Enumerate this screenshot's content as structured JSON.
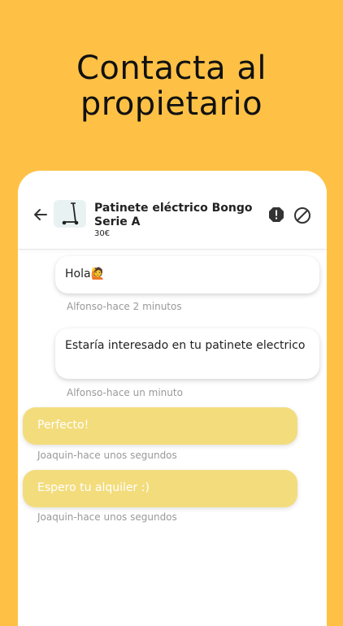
{
  "headline": {
    "line1": "Contacta al",
    "line2": "propietario"
  },
  "chat_header": {
    "product_title": "Patinete eléctrico Bongo Serie A",
    "price": "30€",
    "back_icon": "arrow-left-icon",
    "report_icon": "alert-octagon-icon",
    "block_icon": "block-icon"
  },
  "messages": [
    {
      "sender": "Alfonso",
      "text": "Hola🙋",
      "meta": "Alfonso-hace 2 minutos"
    },
    {
      "sender": "Alfonso",
      "text": "Estaría interesado en tu patinete electrico",
      "meta": "Alfonso-hace un minuto"
    },
    {
      "sender": "Joaquin",
      "text": "Perfecto!",
      "meta": "Joaquin-hace unos segundos"
    },
    {
      "sender": "Joaquin",
      "text": "Espero tu alquiler :)",
      "meta": "Joaquin-hace unos segundos"
    }
  ],
  "colors": {
    "background": "#FFC145",
    "outgoing_bubble": "#F3DC7C"
  }
}
